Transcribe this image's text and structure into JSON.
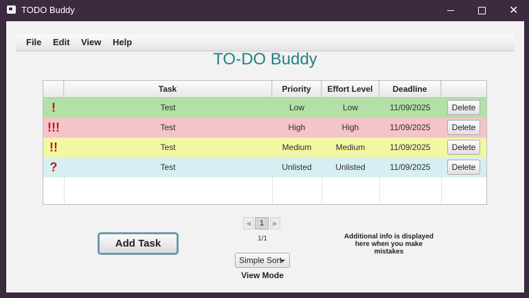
{
  "window": {
    "title": "TODO Buddy"
  },
  "menu": [
    "File",
    "Edit",
    "View",
    "Help"
  ],
  "app_heading": "TO-DO Buddy",
  "table": {
    "columns": [
      "",
      "Task",
      "Priority",
      "Effort Level",
      "Deadline",
      ""
    ],
    "rows": [
      {
        "icon": "!",
        "task": "Test",
        "priority": "Low",
        "effort": "Low",
        "deadline": "11/09/2025",
        "action": "Delete",
        "color": "#b2e0a6"
      },
      {
        "icon": "!!!",
        "task": "Test",
        "priority": "High",
        "effort": "High",
        "deadline": "11/09/2025",
        "action": "Delete",
        "color": "#f4c4c9"
      },
      {
        "icon": "!!",
        "task": "Test",
        "priority": "Medium",
        "effort": "Medium",
        "deadline": "11/09/2025",
        "action": "Delete",
        "color": "#f1f7a3"
      },
      {
        "icon": "?",
        "task": "Test",
        "priority": "Unlisted",
        "effort": "Unlisted",
        "deadline": "11/09/2025",
        "action": "Delete",
        "color": "#d7eef2"
      }
    ]
  },
  "add_task_label": "Add Task",
  "pagination": {
    "prev_icon": "chevron-left-icon",
    "current": "1",
    "next_icon": "chevron-right-icon",
    "count": "1/1"
  },
  "sort": {
    "selected": "Simple Sort",
    "icon": "chevron-down-icon"
  },
  "view_mode_label": "View Mode",
  "info_text": "Additional info is displayed here when you make mistakes"
}
